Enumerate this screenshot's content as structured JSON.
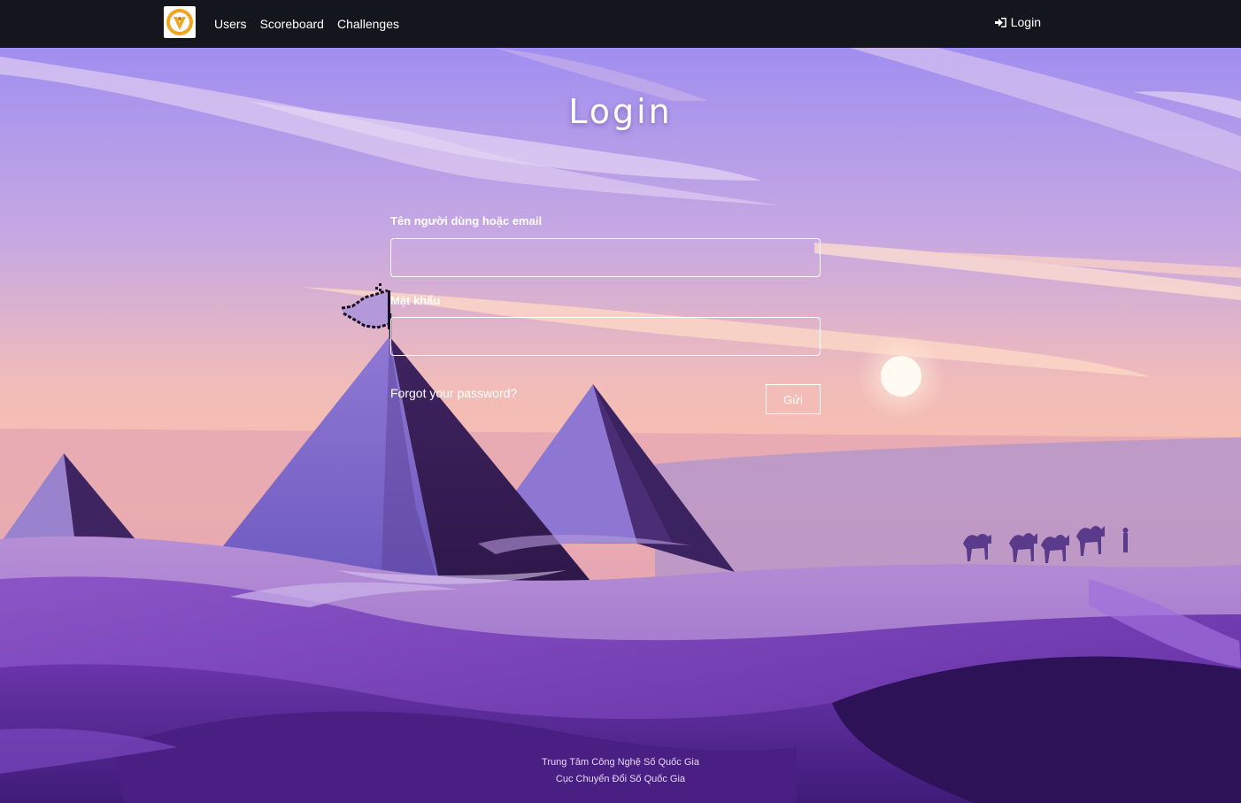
{
  "navbar": {
    "brand_alt": "logo",
    "links": [
      {
        "label": "Users"
      },
      {
        "label": "Scoreboard"
      },
      {
        "label": "Challenges"
      }
    ],
    "login_label": "Login",
    "login_icon": "sign-in-icon"
  },
  "login": {
    "title": "Login",
    "username_label": "Tên người dùng hoặc email",
    "username_value": "",
    "password_label": "Mật khẩu",
    "password_value": "",
    "forgot_label": "Forgot your password?",
    "submit_label": "Gửi"
  },
  "footer": {
    "line1": "Trung Tâm Công Nghệ Số Quốc Gia",
    "line2": "Cục Chuyển Đổi Số Quốc Gia"
  },
  "colors": {
    "navbar_bg": "#13161d",
    "sky_top": "#a18ff0",
    "sky_bottom": "#f4b9a8",
    "dune_purple": "#6a3aa8"
  }
}
